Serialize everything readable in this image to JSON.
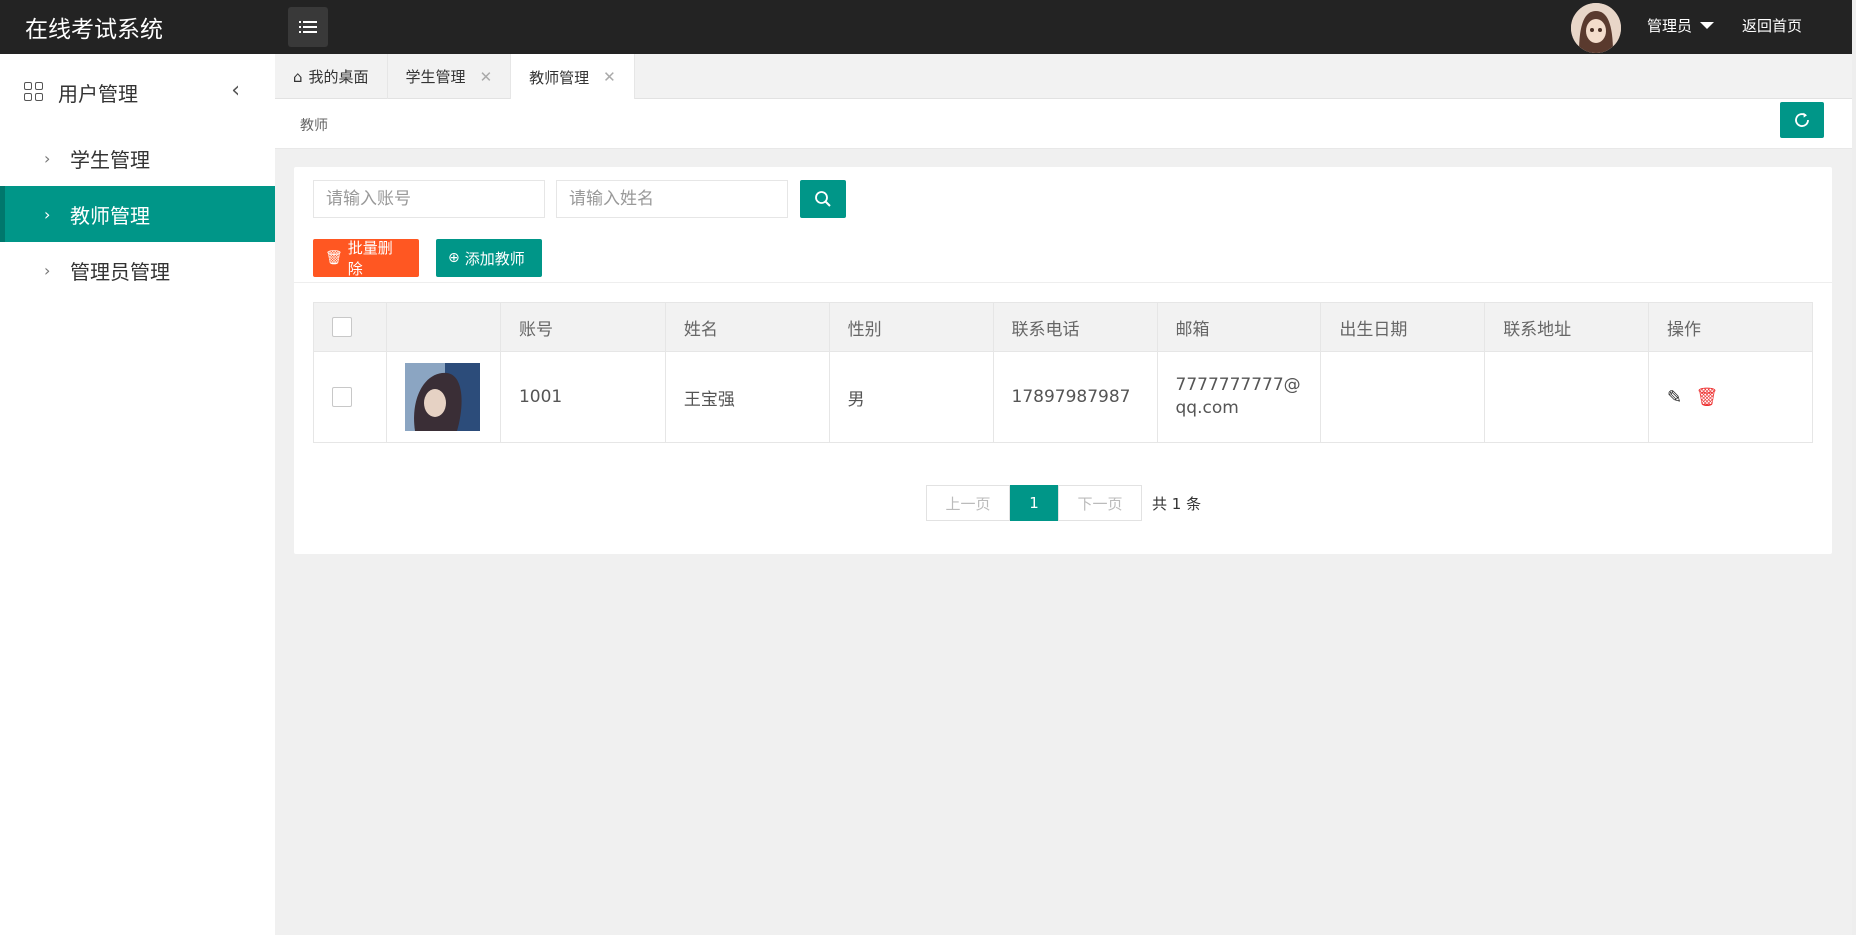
{
  "header": {
    "title": "在线考试系统",
    "user": "管理员",
    "home_link": "返回首页"
  },
  "sidebar": {
    "group_label": "用户管理",
    "items": [
      {
        "label": "学生管理",
        "active": false
      },
      {
        "label": "教师管理",
        "active": true
      },
      {
        "label": "管理员管理",
        "active": false
      }
    ]
  },
  "tabs": [
    {
      "label": "我的桌面",
      "closable": false,
      "active": false
    },
    {
      "label": "学生管理",
      "closable": true,
      "active": false
    },
    {
      "label": "教师管理",
      "closable": true,
      "active": true
    }
  ],
  "breadcrumb": "教师",
  "search": {
    "account_placeholder": "请输入账号",
    "name_placeholder": "请输入姓名"
  },
  "actions": {
    "batch_delete": "批量删除",
    "add_teacher": "添加教师"
  },
  "table": {
    "columns": [
      "",
      "",
      "账号",
      "姓名",
      "性别",
      "联系电话",
      "邮箱",
      "出生日期",
      "联系地址",
      "操作"
    ],
    "rows": [
      {
        "account": "1001",
        "name": "王宝强",
        "gender": "男",
        "phone": "17897987987",
        "email": "7777777777@qq.com",
        "birthday": "",
        "address": ""
      }
    ]
  },
  "pagination": {
    "prev": "上一页",
    "current": "1",
    "next": "下一页",
    "total": "共 1 条"
  },
  "colors": {
    "primary": "#009688",
    "danger": "#ff5722",
    "header_bg": "#232323"
  }
}
